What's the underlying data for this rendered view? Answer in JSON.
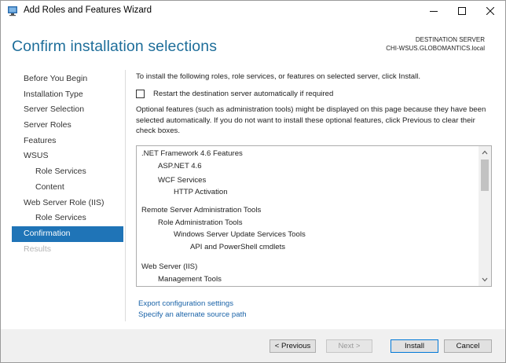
{
  "window": {
    "title": "Add Roles and Features Wizard"
  },
  "header": {
    "page_title": "Confirm installation selections",
    "destination_label": "DESTINATION SERVER",
    "destination_server": "CHI-WSUS.GLOBOMANTICS.local"
  },
  "sidebar": {
    "items": [
      {
        "label": "Before You Begin",
        "state": "normal"
      },
      {
        "label": "Installation Type",
        "state": "normal"
      },
      {
        "label": "Server Selection",
        "state": "normal"
      },
      {
        "label": "Server Roles",
        "state": "normal"
      },
      {
        "label": "Features",
        "state": "normal"
      },
      {
        "label": "WSUS",
        "state": "normal"
      },
      {
        "label": "Role Services",
        "state": "normal"
      },
      {
        "label": "Content",
        "state": "normal"
      },
      {
        "label": "Web Server Role (IIS)",
        "state": "normal"
      },
      {
        "label": "Role Services",
        "state": "normal"
      },
      {
        "label": "Confirmation",
        "state": "active"
      },
      {
        "label": "Results",
        "state": "disabled"
      }
    ]
  },
  "content": {
    "intro": "To install the following roles, role services, or features on selected server, click Install.",
    "restart_checkbox_label": "Restart the destination server automatically if required",
    "restart_checked": false,
    "optional_text": "Optional features (such as administration tools) might be displayed on this page because they have been selected automatically. If you do not want to install these optional features, click Previous to clear their check boxes.",
    "features": [
      {
        "label": ".NET Framework 4.6 Features",
        "level": 0
      },
      {
        "label": "ASP.NET 4.6",
        "level": 1
      },
      {
        "label": "WCF Services",
        "level": 1
      },
      {
        "label": "HTTP Activation",
        "level": 2
      },
      {
        "label": "Remote Server Administration Tools",
        "level": 0
      },
      {
        "label": "Role Administration Tools",
        "level": 1
      },
      {
        "label": "Windows Server Update Services Tools",
        "level": 2
      },
      {
        "label": "API and PowerShell cmdlets",
        "level": 3
      },
      {
        "label": "Web Server (IIS)",
        "level": 0
      },
      {
        "label": "Management Tools",
        "level": 1
      }
    ],
    "links": {
      "export": "Export configuration settings",
      "alternate_source": "Specify an alternate source path"
    }
  },
  "footer": {
    "previous": "< Previous",
    "next": "Next >",
    "install": "Install",
    "cancel": "Cancel"
  },
  "colors": {
    "title_blue": "#1e6e9a",
    "nav_active": "#1f74b7",
    "link_blue": "#1a63a8",
    "footer_bg": "#f0f0f0"
  }
}
